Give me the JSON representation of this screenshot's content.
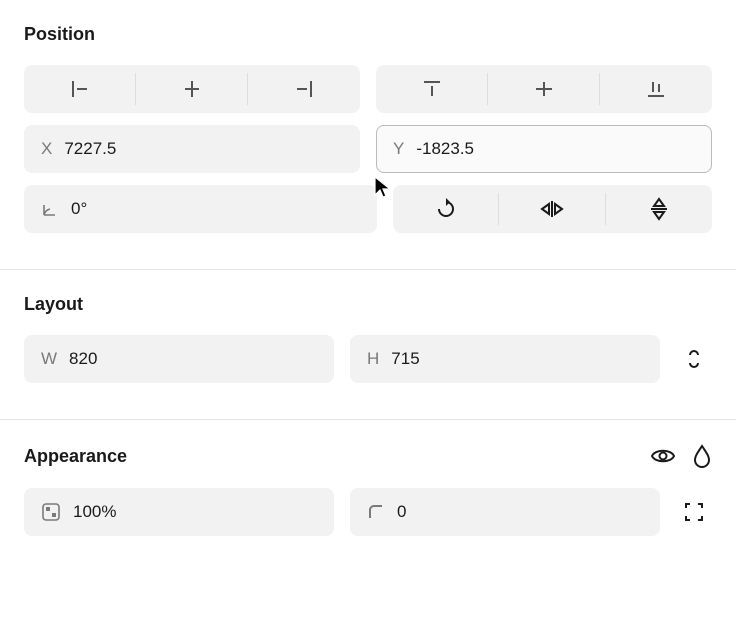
{
  "position": {
    "title": "Position",
    "x_label": "X",
    "x_value": "7227.5",
    "y_label": "Y",
    "y_value": "-1823.5",
    "rotation_value": "0°"
  },
  "layout": {
    "title": "Layout",
    "w_label": "W",
    "w_value": "820",
    "h_label": "H",
    "h_value": "715"
  },
  "appearance": {
    "title": "Appearance",
    "opacity_value": "100%",
    "corner_radius_value": "0"
  }
}
